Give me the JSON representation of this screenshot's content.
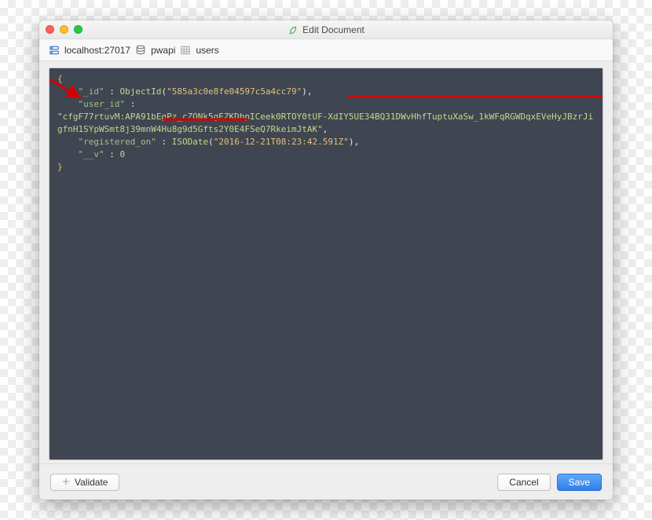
{
  "titlebar": {
    "title": "Edit Document"
  },
  "breadcrumb": {
    "host": "localhost:27017",
    "database": "pwapi",
    "collection": "users"
  },
  "code": {
    "id_key": "\"_id\"",
    "id_fn": "ObjectId",
    "id_val": "\"585a3c0e8fe04597c5a4cc79\"",
    "user_id_key": "\"user_id\"",
    "user_id_val": "\"cfgF77rtuvM:APA91bEgPz_cZONk5gEZKDhpICeek0RTOY0tUF-XdIY5UE34BQ31DWvHhfTuptuXaSw_1kWFqRGWDqxEVeHyJBzrJigfnH1SYpWSmt8j39mnW4Hu8g9d5Gfts2Y0E4FSeQ7RkeimJtAK\"",
    "registered_key": "\"registered_on\"",
    "registered_fn": "ISODate",
    "registered_val": "\"2016-12-21T08:23:42.591Z\"",
    "v_key": "\"__v\"",
    "v_val": "0"
  },
  "footer": {
    "validate": "Validate",
    "cancel": "Cancel",
    "save": "Save"
  }
}
